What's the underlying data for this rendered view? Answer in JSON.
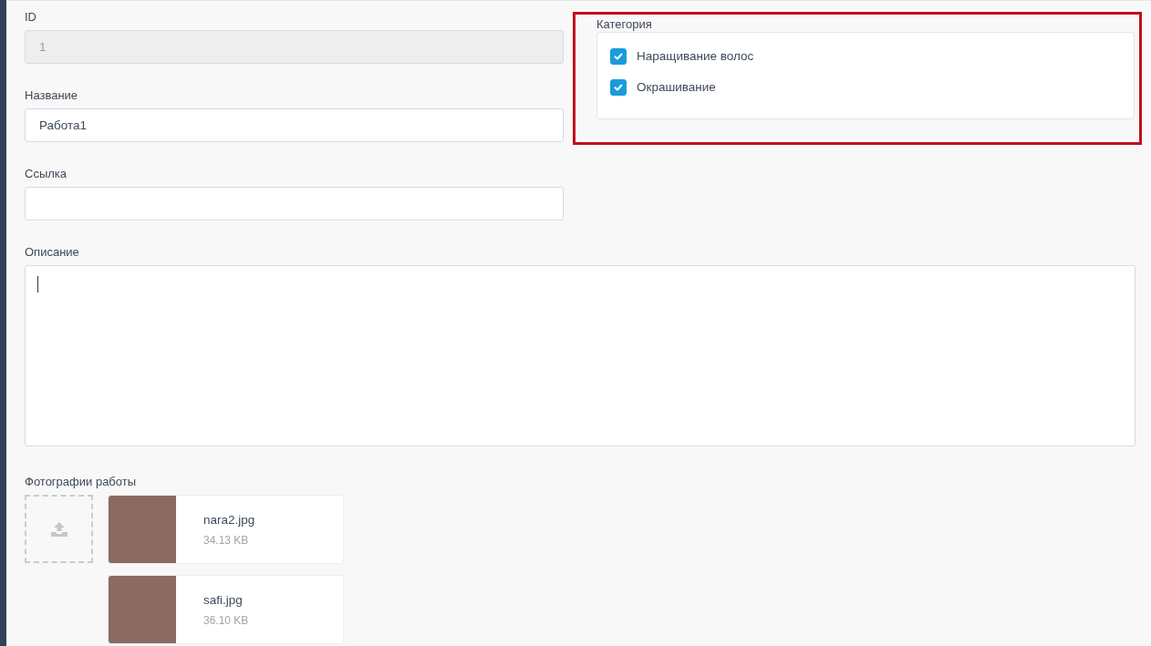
{
  "fields": [
    {
      "label": "ID",
      "value": "1",
      "disabled": true
    },
    {
      "label": "Название",
      "value": "Работа1",
      "disabled": false
    },
    {
      "label": "Ссылка",
      "disabled": false
    }
  ],
  "category": {
    "label": "Категория",
    "highlighted": true,
    "options": [
      {
        "label": "Наращивание волос",
        "checked": true
      },
      {
        "label": "Окрашивание",
        "checked": true
      }
    ]
  },
  "description": {
    "label": "Описание",
    "focused": true
  },
  "photos": {
    "label": "Фотографии работы",
    "files": [
      {
        "name": "nara2.jpg",
        "size": "34.13 KB"
      },
      {
        "name": "safi.jpg",
        "size": "36.10 KB"
      }
    ]
  }
}
